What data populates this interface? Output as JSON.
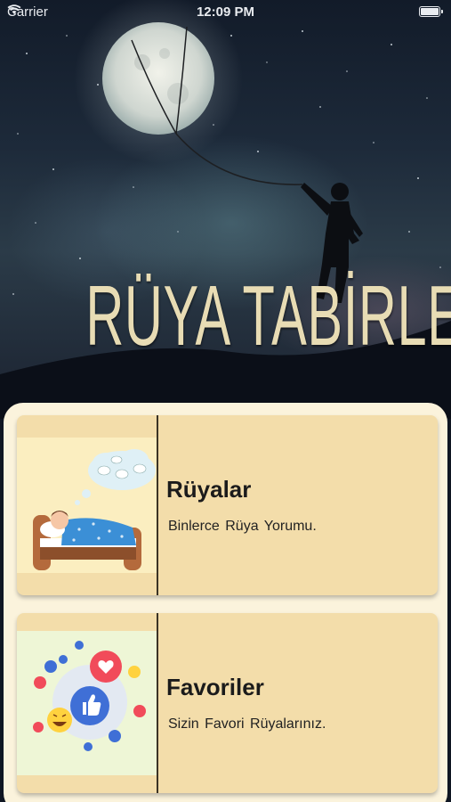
{
  "status_bar": {
    "carrier": "Carrier",
    "time": "12:09 PM",
    "battery_level": 1.0
  },
  "hero": {
    "title": "RÜYA TABİRLERİ"
  },
  "cards": [
    {
      "title": "Rüyalar",
      "subtitle": "Binlerce Rüya Yorumu.",
      "icon": "sleeping-child-illustration"
    },
    {
      "title": "Favoriler",
      "subtitle": "Sizin  Favori  Rüyalarınız.",
      "icon": "social-like-illustration"
    }
  ],
  "colors": {
    "panel_background": "#fbf3dc",
    "card_background": "#f3ddaa",
    "hero_title": "#e8dcb4"
  }
}
